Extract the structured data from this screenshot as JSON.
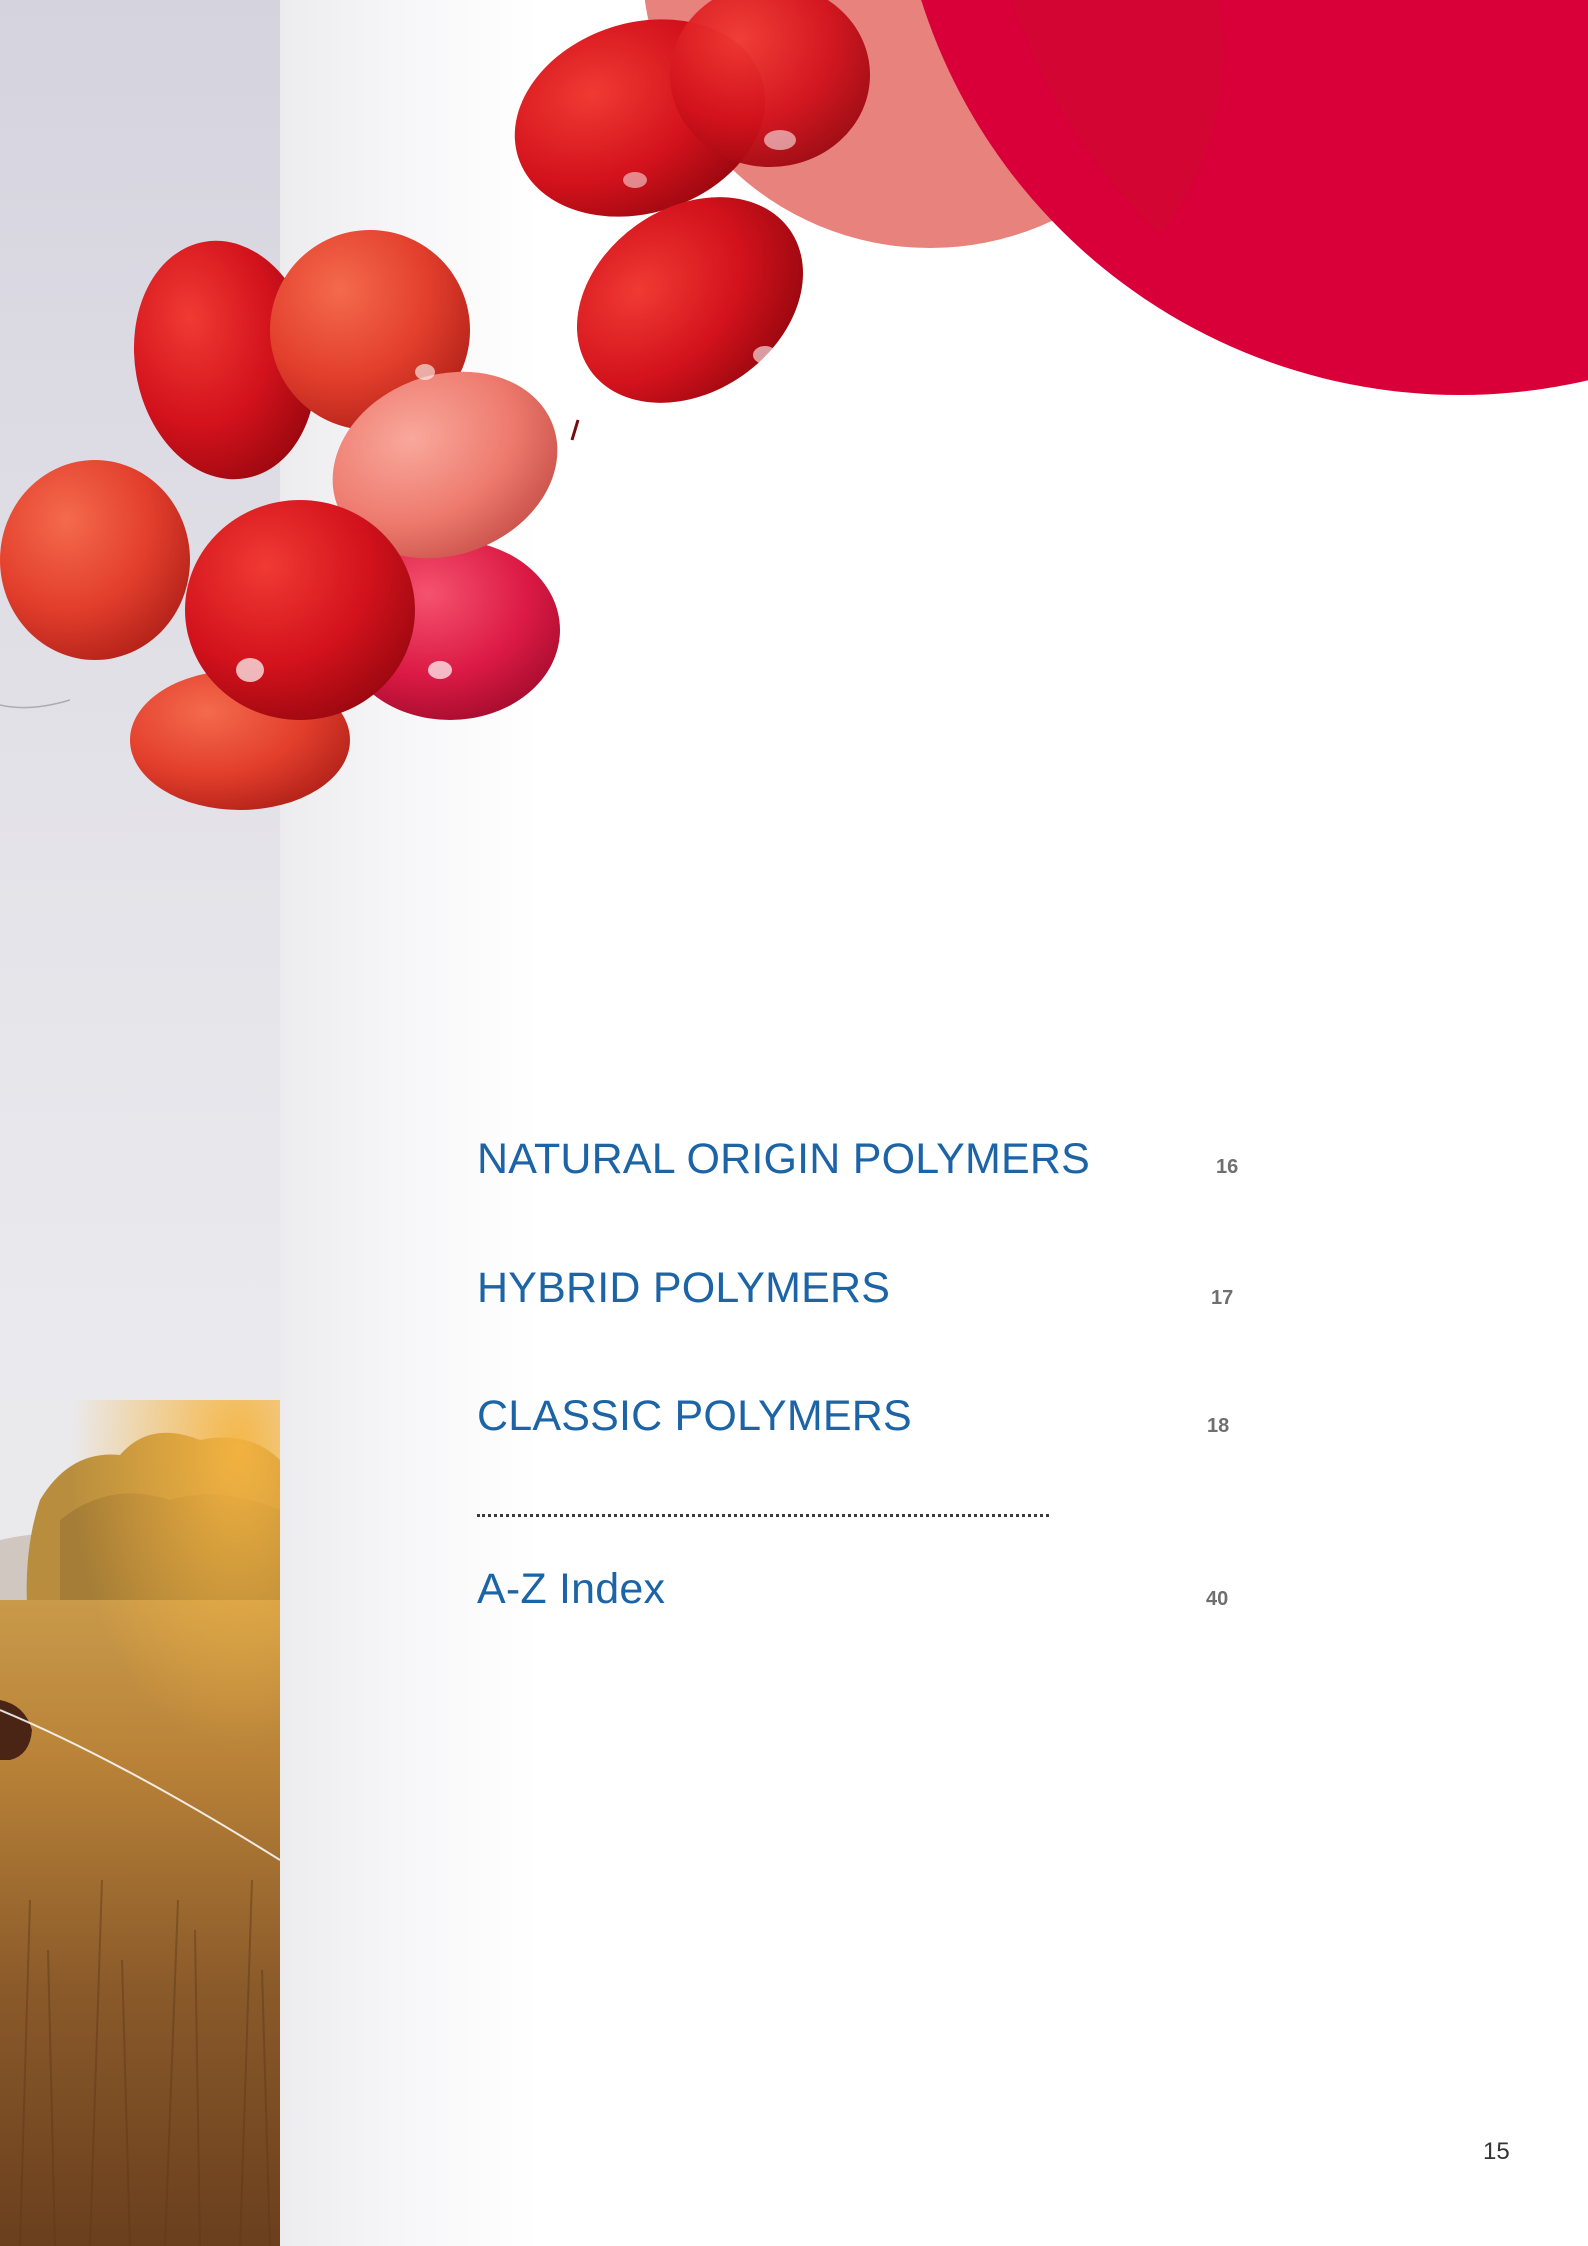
{
  "toc": {
    "entries": [
      {
        "title": "NATURAL ORIGIN POLYMERS",
        "page": "16"
      },
      {
        "title": "HYBRID POLYMERS",
        "page": "17"
      },
      {
        "title": "CLASSIC POLYMERS",
        "page": "18"
      }
    ],
    "index": {
      "title": "A-Z Index",
      "page": "40"
    }
  },
  "footer": {
    "page_number": "15"
  },
  "colors": {
    "heading_blue": "#1c64a6",
    "accent_crimson": "#d9003a",
    "accent_salmon": "#e8827c",
    "balloon_red": "#d0121b"
  },
  "images": {
    "left_photo": "grass-field-sunset-photo",
    "balloons": "red-balloons-cluster"
  }
}
